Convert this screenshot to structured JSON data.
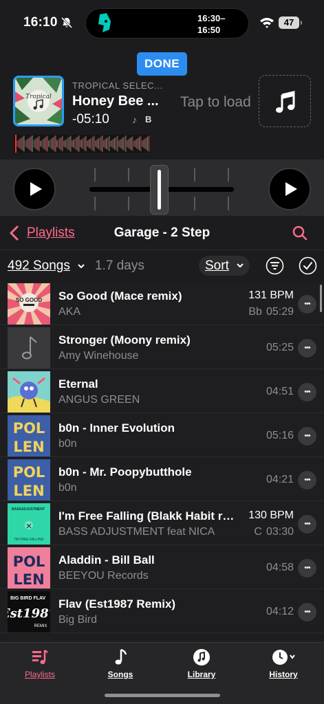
{
  "status": {
    "time": "16:10",
    "island_time_start": "16:30–",
    "island_time_end": "16:50",
    "battery": "47"
  },
  "deck": {
    "done_label": "DONE",
    "source_label": "TROPICAL SELEC...",
    "track_title": "Honey Bee ...",
    "remaining": "-05:10",
    "key": "B",
    "tap_to_load": "Tap to load",
    "cover_text": "Tropical"
  },
  "nav": {
    "back_label": "Playlists",
    "title": "Garage - 2 Step"
  },
  "toolbar": {
    "count": "492 Songs",
    "duration": "1.7 days",
    "sort_label": "Sort"
  },
  "tracks": [
    {
      "title": "So Good (Mace remix)",
      "artist": "AKA",
      "bpm": "131 BPM",
      "key": "Bb",
      "duration": "05:29",
      "thumb": "so-good"
    },
    {
      "title": "Stronger (Moony remix)",
      "artist": "Amy Winehouse",
      "bpm": "",
      "key": "",
      "duration": "05:25",
      "thumb": "placeholder-note"
    },
    {
      "title": "Eternal",
      "artist": "ANGUS GREEN",
      "bpm": "",
      "key": "",
      "duration": "04:51",
      "thumb": "eternal"
    },
    {
      "title": "b0n - Inner Evolution",
      "artist": "b0n",
      "bpm": "",
      "key": "",
      "duration": "05:16",
      "thumb": "pollen"
    },
    {
      "title": "b0n - Mr. Poopybutthole",
      "artist": "b0n",
      "bpm": "",
      "key": "",
      "duration": "04:21",
      "thumb": "pollen"
    },
    {
      "title": "I'm Free Falling (Blakk Habit remix)",
      "artist": "BASS ADJUSTMENT feat NICA",
      "bpm": "130 BPM",
      "key": "C",
      "duration": "03:30",
      "thumb": "free-falling"
    },
    {
      "title": "Aladdin - Bill Ball",
      "artist": "BEEYOU Records",
      "bpm": "",
      "key": "",
      "duration": "04:58",
      "thumb": "pollen-pink"
    },
    {
      "title": "Flav (Est1987 Remix)",
      "artist": "Big Bird",
      "bpm": "",
      "key": "",
      "duration": "04:12",
      "thumb": "flav"
    }
  ],
  "thumb_text": {
    "so_good": "SO GOOD",
    "pollen_top": "POL",
    "pollen_bottom": "LEN",
    "free_falling_brand": "BASSADJUSTMENT",
    "free_falling_title": "I'M FREE FALLING",
    "flav_top": "BIG BIRD FLAV",
    "flav_main": "Est1987",
    "flav_sub": "REMIX"
  },
  "tabs": [
    {
      "label": "Playlists",
      "icon": "playlist-icon",
      "active": true
    },
    {
      "label": "Songs",
      "icon": "music-note-icon",
      "active": false
    },
    {
      "label": "Library",
      "icon": "library-icon",
      "active": false
    },
    {
      "label": "History",
      "icon": "clock-icon",
      "active": false
    }
  ],
  "colors": {
    "accent": "#ff6b8b",
    "done_blue": "#2d8cf0",
    "background": "#1c1c1e"
  }
}
